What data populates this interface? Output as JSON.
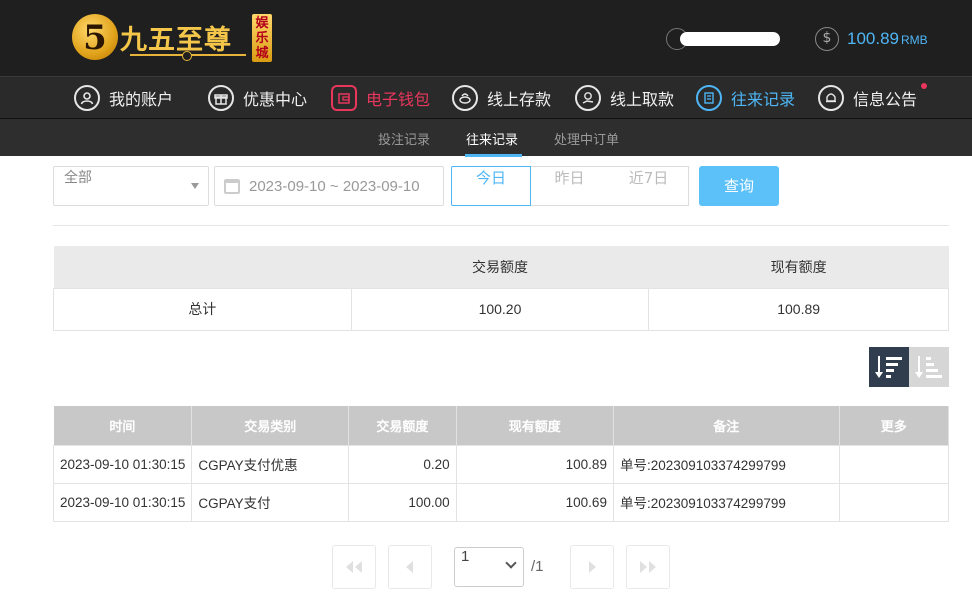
{
  "header": {
    "logo_glyph": "5",
    "brand": "九五至尊",
    "brand_ribbon": "娱乐城",
    "balance_value": "100.89",
    "balance_unit": "RMB"
  },
  "main_nav": [
    {
      "label": "我的账户",
      "icon": "user-icon"
    },
    {
      "label": "优惠中心",
      "icon": "gift-icon"
    },
    {
      "label": "电子钱包",
      "icon": "wallet-icon"
    },
    {
      "label": "线上存款",
      "icon": "deposit-icon"
    },
    {
      "label": "线上取款",
      "icon": "withdraw-icon"
    },
    {
      "label": "往来记录",
      "icon": "records-icon"
    },
    {
      "label": "信息公告",
      "icon": "bell-icon"
    }
  ],
  "sub_nav": [
    "投注记录",
    "往来记录",
    "处理中订单"
  ],
  "filters": {
    "type_selected": "全部",
    "date_range": "2023-09-10 ~ 2023-09-10",
    "quick_ranges": [
      "今日",
      "昨日",
      "近7日"
    ],
    "query_label": "查询"
  },
  "summary": {
    "headers": [
      "",
      "交易额度",
      "现有额度"
    ],
    "row": [
      "总计",
      "100.20",
      "100.89"
    ]
  },
  "records": {
    "headers": [
      "时间",
      "交易类别",
      "交易额度",
      "现有额度",
      "备注",
      "更多"
    ],
    "rows": [
      [
        "2023-09-10 01:30:15",
        "CGPAY支付优惠",
        "0.20",
        "100.89",
        "单号:202309103374299799",
        ""
      ],
      [
        "2023-09-10 01:30:15",
        "CGPAY支付",
        "100.00",
        "100.69",
        "单号:202309103374299799",
        ""
      ]
    ]
  },
  "pagination": {
    "current_page": "1",
    "total_pages": "/1"
  },
  "colors": {
    "accent": "#4eb6f5",
    "wallet_red": "#e8365c",
    "header_bg": "#1f1f1f"
  }
}
